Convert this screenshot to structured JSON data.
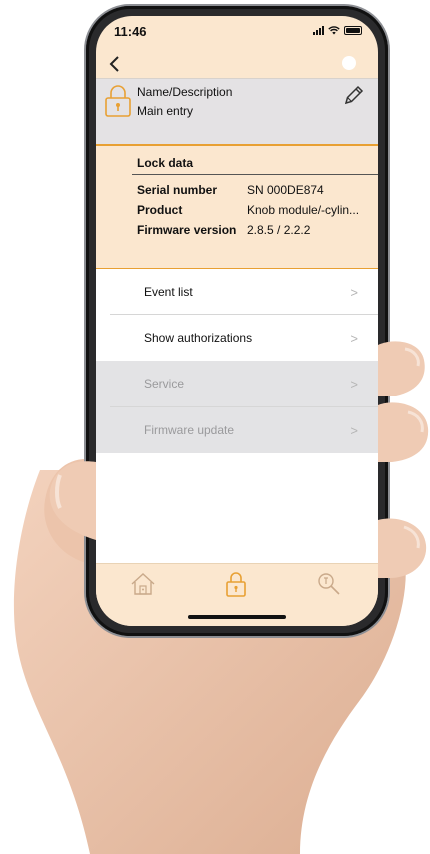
{
  "status_bar": {
    "time": "11:46"
  },
  "nav": {
    "back_icon": "chevron-left-icon"
  },
  "name_section": {
    "label": "Name/Description",
    "value": "Main entry",
    "edit_icon": "pencil-icon",
    "lock_icon": "lock-icon"
  },
  "lock_data": {
    "title": "Lock data",
    "rows": [
      {
        "key": "Serial number",
        "value": "SN 000DE874"
      },
      {
        "key": "Product",
        "value": "Knob module/-cylin..."
      },
      {
        "key": "Firmware version",
        "value": "2.8.5 / 2.2.2"
      }
    ]
  },
  "menu": {
    "items": [
      {
        "label": "Event list",
        "enabled": true
      },
      {
        "label": "Show authorizations",
        "enabled": true
      },
      {
        "label": "Service",
        "enabled": false
      },
      {
        "label": "Firmware update",
        "enabled": false
      }
    ],
    "chevron": ">"
  },
  "tab_bar": {
    "tabs": [
      {
        "icon": "home-icon"
      },
      {
        "icon": "lock-icon",
        "active": true
      },
      {
        "icon": "key-search-icon"
      }
    ]
  },
  "colors": {
    "accent": "#e8a033",
    "panel": "#fbe7cf",
    "disabled_bg": "#e3e3e5"
  }
}
